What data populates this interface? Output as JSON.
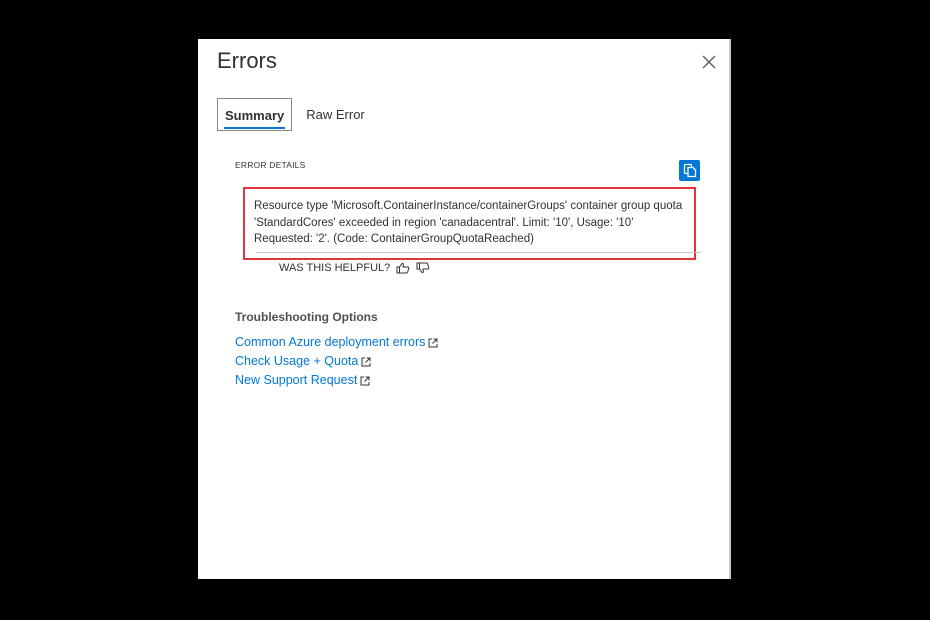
{
  "dialog": {
    "title": "Errors",
    "close_icon": "close-icon"
  },
  "tabs": [
    {
      "label": "Summary",
      "active": true
    },
    {
      "label": "Raw Error",
      "active": false
    }
  ],
  "error_details": {
    "label": "ERROR DETAILS",
    "copy_icon": "copy-icon",
    "message": "Resource type 'Microsoft.ContainerInstance/containerGroups' container group quota 'StandardCores' exceeded in region 'canadacentral'. Limit: '10', Usage: '10' Requested: '2'. (Code: ContainerGroupQuotaReached)",
    "highlight_color": "#e3343a"
  },
  "feedback": {
    "label": "WAS THIS HELPFUL?",
    "thumbs_up_icon": "thumbs-up-icon",
    "thumbs_down_icon": "thumbs-down-icon"
  },
  "troubleshooting": {
    "title": "Troubleshooting Options",
    "links": [
      {
        "label": "Common Azure deployment errors",
        "icon": "external-link-icon"
      },
      {
        "label": "Check Usage + Quota",
        "icon": "external-link-icon"
      },
      {
        "label": "New Support Request",
        "icon": "external-link-icon"
      }
    ]
  },
  "colors": {
    "accent": "#0078d4",
    "text": "#323130"
  }
}
